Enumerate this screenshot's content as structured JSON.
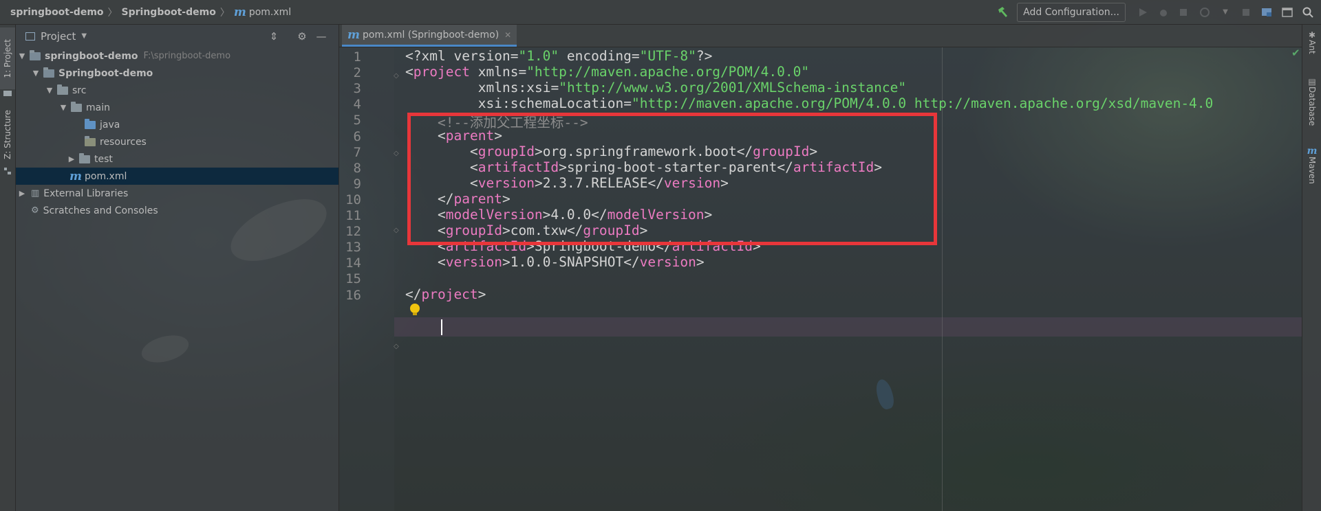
{
  "breadcrumb": {
    "project": "springboot-demo",
    "module": "Springboot-demo",
    "file": "pom.xml",
    "file_icon": "m"
  },
  "toolbar": {
    "add_configuration": "Add Configuration..."
  },
  "left_tabs": {
    "project": "1: Project",
    "structure": "Z: Structure"
  },
  "right_tabs": {
    "ant": "Ant",
    "database": "Database",
    "maven": "Maven"
  },
  "project_panel": {
    "title": "Project",
    "tree": [
      {
        "label": "springboot-demo",
        "path": "F:\\springboot-demo",
        "expanded": true
      },
      {
        "label": "Springboot-demo",
        "expanded": true
      },
      {
        "label": "src",
        "expanded": true
      },
      {
        "label": "main",
        "expanded": true
      },
      {
        "label": "java"
      },
      {
        "label": "resources"
      },
      {
        "label": "test",
        "expanded": false
      },
      {
        "label": "pom.xml",
        "selected": true
      },
      {
        "label": "External Libraries",
        "expanded": false
      },
      {
        "label": "Scratches and Consoles"
      }
    ]
  },
  "editor": {
    "tab_label": "pom.xml (Springboot-demo)",
    "current_line": 15,
    "lines": [
      {
        "n": "1",
        "text": "<?xml version=\"1.0\" encoding=\"UTF-8\"?>"
      },
      {
        "n": "2",
        "text": "<project xmlns=\"http://maven.apache.org/POM/4.0.0\""
      },
      {
        "n": "3",
        "text": "         xmlns:xsi=\"http://www.w3.org/2001/XMLSchema-instance\""
      },
      {
        "n": "4",
        "text": "         xsi:schemaLocation=\"http://maven.apache.org/POM/4.0.0 http://maven.apache.org/xsd/maven-4.0"
      },
      {
        "n": "5",
        "text": "    <!--添加父工程坐标-->"
      },
      {
        "n": "6",
        "text": "    <parent>"
      },
      {
        "n": "7",
        "text": "        <groupId>org.springframework.boot</groupId>"
      },
      {
        "n": "8",
        "text": "        <artifactId>spring-boot-starter-parent</artifactId>"
      },
      {
        "n": "9",
        "text": "        <version>2.3.7.RELEASE</version>"
      },
      {
        "n": "10",
        "text": "    </parent>"
      },
      {
        "n": "11",
        "text": "    <modelVersion>4.0.0</modelVersion>"
      },
      {
        "n": "12",
        "text": "    <groupId>com.txw</groupId>"
      },
      {
        "n": "13",
        "text": "    <artifactId>Springboot-demo</artifactId>"
      },
      {
        "n": "14",
        "text": "    <version>1.0.0-SNAPSHOT</version>"
      },
      {
        "n": "15",
        "text": ""
      },
      {
        "n": "16",
        "text": "</project>"
      }
    ]
  },
  "colors": {
    "tag": "#ec7bc2",
    "string": "#6ad36a",
    "comment": "#8c8c8c",
    "highlight_box": "#e8363a",
    "selection": "#0d293e"
  },
  "icons": [
    "hammer-icon",
    "run-icon",
    "debug-icon",
    "coverage-icon",
    "profile-icon",
    "stop-icon",
    "project-structure-icon",
    "terminal-icon",
    "search-icon",
    "gear-icon",
    "collapse-all-icon",
    "hide-icon",
    "intention-bulb-icon",
    "check-icon"
  ]
}
